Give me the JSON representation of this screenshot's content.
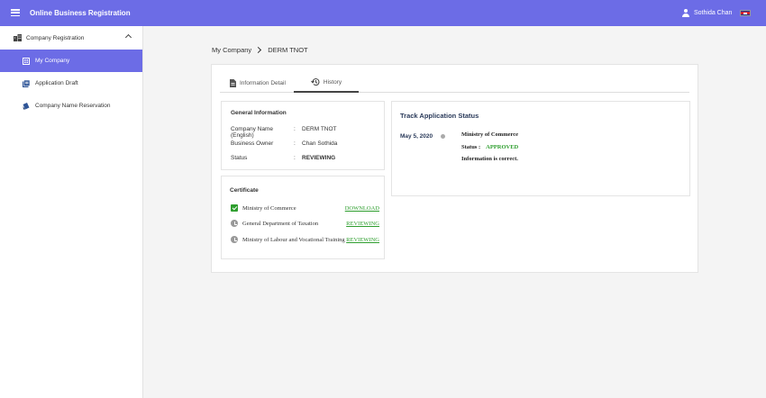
{
  "header": {
    "title": "Online Business Registration",
    "user_name": "Sothida Chan"
  },
  "sidebar": {
    "section": "Company Registration",
    "items": [
      {
        "label": "My Company"
      },
      {
        "label": "Application Draft"
      },
      {
        "label": "Company Name Reservation"
      }
    ]
  },
  "breadcrumb": {
    "parent": "My Company",
    "current": "DERM TNOT"
  },
  "tabs": [
    {
      "label": "Information Detail"
    },
    {
      "label": "History"
    }
  ],
  "general_info": {
    "title": "General Information",
    "rows": [
      {
        "label": "Company Name (English)",
        "colon": ":",
        "value": "DERM TNOT"
      },
      {
        "label": "Business Owner",
        "colon": ":",
        "value": "Chan Sothida"
      },
      {
        "label": "Status",
        "colon": ":",
        "value": "REVIEWING"
      }
    ]
  },
  "certificate": {
    "title": "Certificate",
    "rows": [
      {
        "name": "Ministry of Commerce",
        "action": "DOWNLOAD",
        "icon": "check-icon"
      },
      {
        "name": "General Department of Taxation",
        "action": "REVIEWING",
        "icon": "clock-icon"
      },
      {
        "name": "Ministry of Labour and Vocational Training",
        "action": "REVIEWING",
        "icon": "clock-icon"
      }
    ]
  },
  "track": {
    "title": "Track Application Status",
    "date": "May 5, 2020",
    "ministry": "Ministry of Commerce",
    "status_label": "Status :",
    "status_value": "APPROVED",
    "note": "Information is correct."
  },
  "colors": {
    "accent": "#6c6ce6",
    "success": "#2e9e2e"
  }
}
